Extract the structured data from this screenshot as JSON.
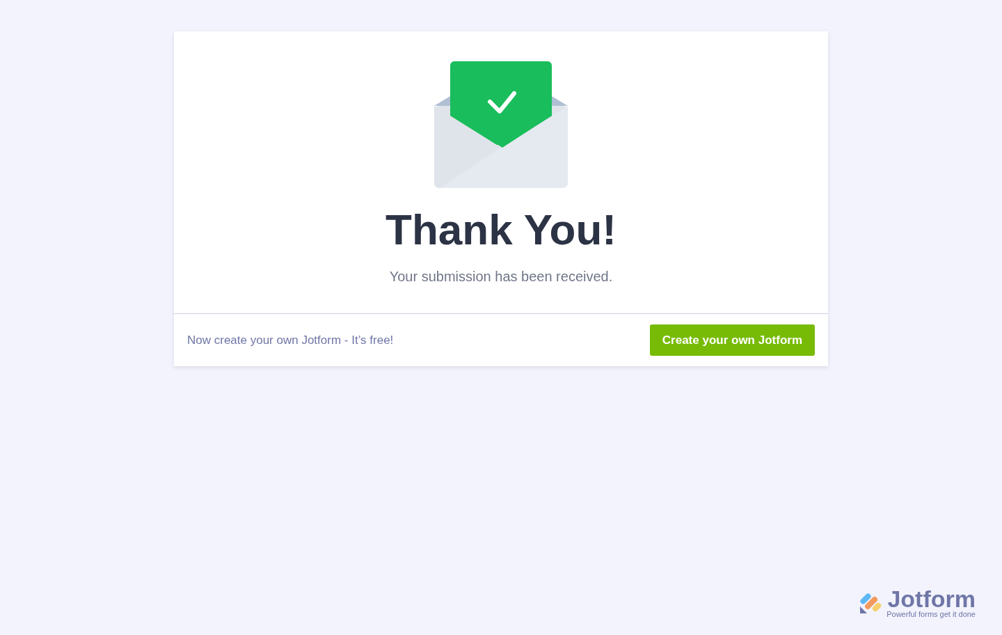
{
  "card": {
    "title": "Thank You!",
    "message": "Your submission has been received."
  },
  "footer": {
    "text": "Now create your own Jotform - It’s free!",
    "button": "Create your own Jotform"
  },
  "branding": {
    "name": "Jotform",
    "tagline": "Powerful forms get it done"
  }
}
